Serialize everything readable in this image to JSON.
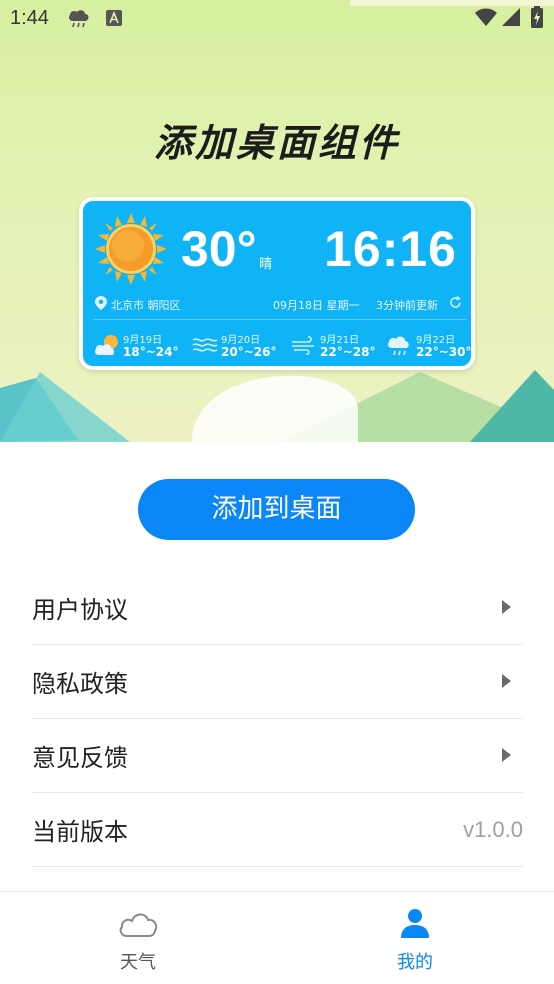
{
  "status_bar": {
    "time": "1:44",
    "icons": [
      "cloud-rain-icon",
      "a-notification-icon",
      "wifi-icon",
      "signal-icon",
      "battery-charging-icon"
    ]
  },
  "hero": {
    "title": "添加桌面组件"
  },
  "widget": {
    "temperature": "30°",
    "condition": "晴",
    "time": "16:16",
    "location": "北京市 朝阳区",
    "date": "09月18日 星期一",
    "updated": "3分钟前更新",
    "forecast": [
      {
        "date": "9月19日",
        "range": "18°~24°",
        "icon": "partly-cloudy-icon"
      },
      {
        "date": "9月20日",
        "range": "20°~26°",
        "icon": "haze-icon"
      },
      {
        "date": "9月21日",
        "range": "22°~28°",
        "icon": "wind-icon"
      },
      {
        "date": "9月22日",
        "range": "22°~30°",
        "icon": "rain-icon"
      }
    ]
  },
  "add_button": {
    "label": "添加到桌面"
  },
  "menu": [
    {
      "label": "用户协议"
    },
    {
      "label": "隐私政策"
    },
    {
      "label": "意见反馈"
    },
    {
      "label": "当前版本",
      "value": "v1.0.0"
    }
  ],
  "bottom_nav": [
    {
      "label": "天气",
      "icon": "cloud-icon",
      "active": false
    },
    {
      "label": "我的",
      "icon": "user-icon",
      "active": true
    }
  ],
  "colors": {
    "accent": "#0A86F7",
    "widget_bg": "#0FB3F6",
    "nav_inactive": "#555555"
  }
}
